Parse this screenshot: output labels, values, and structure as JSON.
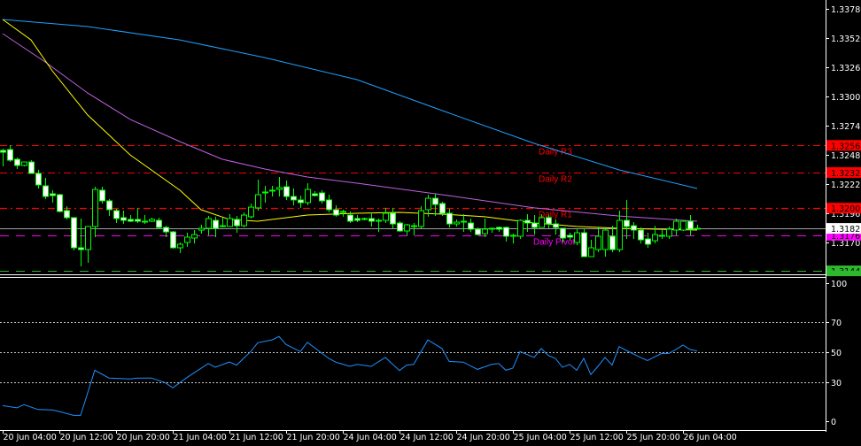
{
  "chart_data": {
    "type": "candlestick",
    "timeframe_hours": 1,
    "colors": {
      "background": "#000000",
      "candle_outline": "#00ff00",
      "bear_body": "#ffffff",
      "bull_body": "#000000",
      "ma_slow": "#20a0ff",
      "ma_mid": "#c060e0",
      "ma_fast": "#ffff00",
      "rsi": "#1e90ff",
      "r_levels": "#ff0000",
      "pivot": "#ff00ff",
      "s_level": "#2eb82e",
      "current_price": "#a0a0a0",
      "axis": "#ffffff"
    },
    "price_axis": {
      "ticks": [
        "1.33780",
        "1.33520",
        "1.33265",
        "1.33005",
        "1.32745",
        "1.32485",
        "1.32225",
        "1.31965",
        "1.31705"
      ],
      "ylim": [
        1.3142,
        1.33866
      ]
    },
    "time_axis": {
      "labels": [
        "20 Jun 04:00",
        "20 Jun 12:00",
        "20 Jun 20:00",
        "21 Jun 04:00",
        "21 Jun 12:00",
        "21 Jun 20:00",
        "24 Jun 04:00",
        "24 Jun 12:00",
        "24 Jun 20:00",
        "25 Jun 04:00",
        "25 Jun 12:00",
        "25 Jun 20:00",
        "26 Jun 04:00"
      ],
      "label_every_n_bars": 8
    },
    "ohlc_fields": [
      "open",
      "high",
      "low",
      "close"
    ],
    "candles": [
      [
        1.32523,
        1.32539,
        1.32381,
        1.32507
      ],
      [
        1.32531,
        1.3257,
        1.3242,
        1.32436
      ],
      [
        1.32444,
        1.3246,
        1.32357,
        1.32389
      ],
      [
        1.32389,
        1.3242,
        1.32381,
        1.3242
      ],
      [
        1.3242,
        1.32436,
        1.32318,
        1.32318
      ],
      [
        1.32318,
        1.32349,
        1.32183,
        1.32215
      ],
      [
        1.32207,
        1.32278,
        1.32089,
        1.32112
      ],
      [
        1.32136,
        1.32168,
        1.32057,
        1.3212
      ],
      [
        1.32128,
        1.32136,
        1.3197,
        1.31978
      ],
      [
        1.31986,
        1.32025,
        1.31907,
        1.31923
      ],
      [
        1.31923,
        1.31923,
        1.3163,
        1.31654
      ],
      [
        1.31654,
        1.31915,
        1.31488,
        1.31638
      ],
      [
        1.31638,
        1.31844,
        1.3152,
        1.31844
      ],
      [
        1.31844,
        1.32199,
        1.31749,
        1.32175
      ],
      [
        1.32168,
        1.32199,
        1.32049,
        1.32073
      ],
      [
        1.32073,
        1.32089,
        1.31938,
        1.31994
      ],
      [
        1.31986,
        1.32002,
        1.31875,
        1.31915
      ],
      [
        1.31923,
        1.31986,
        1.31867,
        1.31899
      ],
      [
        1.31907,
        1.31946,
        1.31883,
        1.31891
      ],
      [
        1.31907,
        1.3201,
        1.31875,
        1.31891
      ],
      [
        1.31883,
        1.31946,
        1.31867,
        1.31891
      ],
      [
        1.31891,
        1.31923,
        1.31883,
        1.31907
      ],
      [
        1.31899,
        1.31923,
        1.3182,
        1.31836
      ],
      [
        1.31836,
        1.31851,
        1.31749,
        1.31796
      ],
      [
        1.31796,
        1.31804,
        1.31646,
        1.31654
      ],
      [
        1.31654,
        1.31701,
        1.31607,
        1.31686
      ],
      [
        1.31701,
        1.31788,
        1.31662,
        1.31749
      ],
      [
        1.31741,
        1.31812,
        1.31693,
        1.31772
      ],
      [
        1.31812,
        1.31859,
        1.3178,
        1.31828
      ],
      [
        1.31828,
        1.31938,
        1.31765,
        1.31915
      ],
      [
        1.31899,
        1.31931,
        1.31749,
        1.31828
      ],
      [
        1.31851,
        1.31923,
        1.31836,
        1.31844
      ],
      [
        1.31844,
        1.31954,
        1.31844,
        1.31915
      ],
      [
        1.31907,
        1.31938,
        1.31788,
        1.31851
      ],
      [
        1.31851,
        1.3197,
        1.31836,
        1.31946
      ],
      [
        1.31931,
        1.32049,
        1.31915,
        1.32017
      ],
      [
        1.3201,
        1.32262,
        1.31986,
        1.32128
      ],
      [
        1.32144,
        1.32207,
        1.32057,
        1.32152
      ],
      [
        1.32168,
        1.32207,
        1.32112,
        1.3216
      ],
      [
        1.32175,
        1.32286,
        1.32112,
        1.32191
      ],
      [
        1.32199,
        1.32254,
        1.32081,
        1.32112
      ],
      [
        1.32112,
        1.32183,
        1.32033,
        1.32081
      ],
      [
        1.32081,
        1.3212,
        1.3201,
        1.32057
      ],
      [
        1.32057,
        1.32231,
        1.32033,
        1.32175
      ],
      [
        1.32136,
        1.3216,
        1.32112,
        1.3212
      ],
      [
        1.32144,
        1.32168,
        1.32049,
        1.32073
      ],
      [
        1.32081,
        1.32128,
        1.3197,
        1.31994
      ],
      [
        1.31994,
        1.32033,
        1.31931,
        1.31946
      ],
      [
        1.31978,
        1.31994,
        1.31931,
        1.3197
      ],
      [
        1.31946,
        1.31978,
        1.31875,
        1.31891
      ],
      [
        1.31915,
        1.31946,
        1.31883,
        1.31899
      ],
      [
        1.31915,
        1.31923,
        1.31899,
        1.31907
      ],
      [
        1.31915,
        1.3197,
        1.31844,
        1.31891
      ],
      [
        1.31899,
        1.31915,
        1.31796,
        1.31891
      ],
      [
        1.31899,
        1.3201,
        1.31875,
        1.31962
      ],
      [
        1.31962,
        1.3201,
        1.31828,
        1.31867
      ],
      [
        1.31875,
        1.31891,
        1.31796,
        1.31804
      ],
      [
        1.31804,
        1.31867,
        1.31765,
        1.31859
      ],
      [
        1.31851,
        1.31875,
        1.31765,
        1.31851
      ],
      [
        1.31844,
        1.32025,
        1.31828,
        1.31986
      ],
      [
        1.31994,
        1.32128,
        1.31931,
        1.32096
      ],
      [
        1.32096,
        1.32136,
        1.31938,
        1.32041
      ],
      [
        1.32049,
        1.32065,
        1.31938,
        1.31962
      ],
      [
        1.31962,
        1.32002,
        1.31836,
        1.31867
      ],
      [
        1.31867,
        1.31907,
        1.31844,
        1.31883
      ],
      [
        1.31891,
        1.31954,
        1.31796,
        1.31891
      ],
      [
        1.31875,
        1.31915,
        1.31796,
        1.3182
      ],
      [
        1.3182,
        1.31836,
        1.31765,
        1.31772
      ],
      [
        1.3178,
        1.31915,
        1.31749,
        1.3182
      ],
      [
        1.31828,
        1.31836,
        1.31788,
        1.31828
      ],
      [
        1.31836,
        1.31844,
        1.31796,
        1.3182
      ],
      [
        1.31836,
        1.31844,
        1.31709,
        1.31757
      ],
      [
        1.31765,
        1.3178,
        1.31693,
        1.31757
      ],
      [
        1.31757,
        1.31907,
        1.31733,
        1.31899
      ],
      [
        1.31899,
        1.31954,
        1.31796,
        1.31875
      ],
      [
        1.31875,
        1.31946,
        1.31772,
        1.31836
      ],
      [
        1.31836,
        1.31954,
        1.31836,
        1.31923
      ],
      [
        1.31923,
        1.31946,
        1.31828,
        1.31867
      ],
      [
        1.31867,
        1.31907,
        1.31772,
        1.31836
      ],
      [
        1.31828,
        1.31828,
        1.31701,
        1.31741
      ],
      [
        1.31765,
        1.31788,
        1.31725,
        1.31749
      ],
      [
        1.31701,
        1.31828,
        1.31678,
        1.31788
      ],
      [
        1.31788,
        1.31828,
        1.31575,
        1.31575
      ],
      [
        1.31575,
        1.31725,
        1.31575,
        1.31654
      ],
      [
        1.31638,
        1.31844,
        1.31615,
        1.31757
      ],
      [
        1.31638,
        1.31828,
        1.31575,
        1.31812
      ],
      [
        1.31757,
        1.31851,
        1.31615,
        1.31638
      ],
      [
        1.31638,
        1.31986,
        1.31615,
        1.31899
      ],
      [
        1.31899,
        1.32081,
        1.31733,
        1.31844
      ],
      [
        1.31851,
        1.31883,
        1.31733,
        1.31812
      ],
      [
        1.31812,
        1.31836,
        1.31693,
        1.31725
      ],
      [
        1.31733,
        1.31788,
        1.31654,
        1.31686
      ],
      [
        1.31717,
        1.31851,
        1.31693,
        1.31772
      ],
      [
        1.31765,
        1.31812,
        1.31733,
        1.31765
      ],
      [
        1.31757,
        1.31844,
        1.31733,
        1.3182
      ],
      [
        1.31812,
        1.31915,
        1.31765,
        1.31891
      ],
      [
        1.31812,
        1.31891,
        1.31804,
        1.31891
      ],
      [
        1.31891,
        1.31946,
        1.31765,
        1.3182
      ],
      [
        1.31828,
        1.31859,
        1.3182,
        1.31828
      ]
    ],
    "moving_averages": [
      {
        "color_key": "ma_slow",
        "points": [
          [
            0,
            1.33692
          ],
          [
            12,
            1.33629
          ],
          [
            25,
            1.3351
          ],
          [
            37,
            1.33352
          ],
          [
            50,
            1.33155
          ],
          [
            62,
            1.32879
          ],
          [
            75,
            1.32586
          ],
          [
            87,
            1.32349
          ],
          [
            98,
            1.32183
          ]
        ]
      },
      {
        "color_key": "ma_mid",
        "points": [
          [
            0,
            1.33566
          ],
          [
            6,
            1.33313
          ],
          [
            12,
            1.33036
          ],
          [
            18,
            1.328
          ],
          [
            25,
            1.32602
          ],
          [
            31,
            1.32444
          ],
          [
            37,
            1.32357
          ],
          [
            43,
            1.32286
          ],
          [
            50,
            1.32231
          ],
          [
            62,
            1.32128
          ],
          [
            75,
            1.3201
          ],
          [
            87,
            1.31938
          ],
          [
            98,
            1.31891
          ]
        ]
      },
      {
        "color_key": "ma_fast",
        "points": [
          [
            0,
            1.33692
          ],
          [
            4,
            1.3351
          ],
          [
            7,
            1.33234
          ],
          [
            12,
            1.32839
          ],
          [
            18,
            1.32483
          ],
          [
            25,
            1.32168
          ],
          [
            28,
            1.31994
          ],
          [
            32,
            1.31907
          ],
          [
            36,
            1.31891
          ],
          [
            43,
            1.31946
          ],
          [
            50,
            1.31962
          ],
          [
            56,
            1.3197
          ],
          [
            62,
            1.31954
          ],
          [
            68,
            1.31931
          ],
          [
            75,
            1.31875
          ],
          [
            81,
            1.31844
          ],
          [
            87,
            1.31828
          ],
          [
            98,
            1.31812
          ]
        ]
      }
    ],
    "levels": [
      {
        "label": "Daily R3",
        "price": 1.32568,
        "tag": "1.32568",
        "color_key": "r_levels",
        "style": "dashdot"
      },
      {
        "label": "Daily R2",
        "price": 1.32326,
        "tag": "1.32326",
        "color_key": "r_levels",
        "style": "dashdot"
      },
      {
        "label": "Daily R1",
        "price": 1.32008,
        "tag": "1.32008",
        "color_key": "r_levels",
        "style": "dashdot"
      },
      {
        "label": "Daily Pivot",
        "price": 1.31766,
        "tag": "1.31766",
        "color_key": "pivot",
        "style": "dash"
      },
      {
        "label": "",
        "price": 1.31448,
        "tag": "1.31448",
        "color_key": "s_level",
        "style": "dash"
      }
    ],
    "current_price": {
      "price": 1.31827,
      "tag": "1.31827"
    },
    "rsi": {
      "ylim": [
        0,
        100
      ],
      "levels": [
        70,
        50,
        30
      ],
      "tick_labels": [
        "100",
        "70",
        "50",
        "30",
        "0"
      ],
      "points": [
        [
          0,
          14.5
        ],
        [
          2,
          13
        ],
        [
          3,
          15.1
        ],
        [
          5,
          11.9
        ],
        [
          7,
          11.6
        ],
        [
          8,
          10.6
        ],
        [
          10,
          8
        ],
        [
          11,
          8
        ],
        [
          13,
          38
        ],
        [
          15,
          32.8
        ],
        [
          18,
          32.2
        ],
        [
          19,
          32.8
        ],
        [
          21,
          32.8
        ],
        [
          23,
          29.6
        ],
        [
          24,
          26.3
        ],
        [
          26,
          33.1
        ],
        [
          29,
          42.5
        ],
        [
          30,
          40
        ],
        [
          32,
          43.5
        ],
        [
          33,
          41.4
        ],
        [
          35,
          50.4
        ],
        [
          36,
          56.3
        ],
        [
          38,
          58.2
        ],
        [
          39,
          60.4
        ],
        [
          40,
          55.1
        ],
        [
          42,
          50.4
        ],
        [
          43,
          56.6
        ],
        [
          46,
          45.9
        ],
        [
          47,
          43.4
        ],
        [
          49,
          40.6
        ],
        [
          50,
          41.9
        ],
        [
          52,
          40.6
        ],
        [
          54,
          46.5
        ],
        [
          56,
          37.8
        ],
        [
          57,
          41.4
        ],
        [
          58,
          41.9
        ],
        [
          60,
          58.2
        ],
        [
          62,
          52.4
        ],
        [
          63,
          43.9
        ],
        [
          65,
          43.4
        ],
        [
          67,
          38.6
        ],
        [
          69,
          41.9
        ],
        [
          70,
          42.5
        ],
        [
          71,
          38
        ],
        [
          72,
          39.4
        ],
        [
          73,
          50.4
        ],
        [
          75,
          46.5
        ],
        [
          76,
          52.4
        ],
        [
          77,
          47.8
        ],
        [
          78,
          45.9
        ],
        [
          79,
          40
        ],
        [
          80,
          41.9
        ],
        [
          81,
          38
        ],
        [
          82,
          45.9
        ],
        [
          83,
          35.1
        ],
        [
          84,
          40.6
        ],
        [
          85,
          46.5
        ],
        [
          86,
          41.4
        ],
        [
          87,
          53.7
        ],
        [
          88,
          51.2
        ],
        [
          90,
          46.5
        ],
        [
          91,
          44.5
        ],
        [
          92,
          46.9
        ],
        [
          93,
          49.2
        ],
        [
          94,
          49.2
        ],
        [
          95,
          51.8
        ],
        [
          96,
          54.7
        ],
        [
          97,
          51.8
        ],
        [
          98,
          50.8
        ]
      ]
    }
  }
}
